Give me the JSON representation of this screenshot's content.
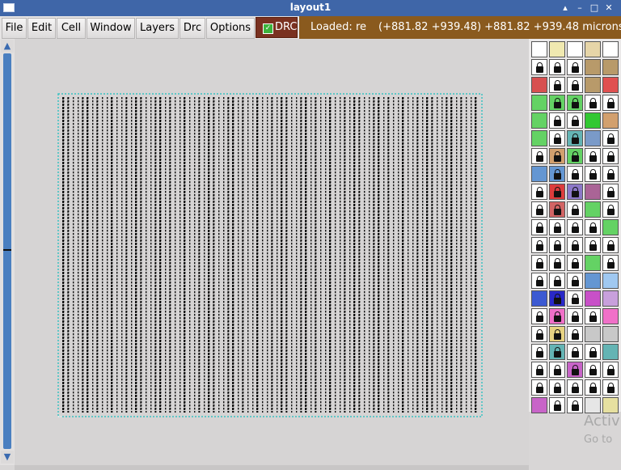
{
  "window": {
    "title": "layout1",
    "controls": [
      "▴",
      "–",
      "□",
      "✕"
    ]
  },
  "menu": [
    {
      "label": "File"
    },
    {
      "label": "Edit"
    },
    {
      "label": "Cell"
    },
    {
      "label": "Window"
    },
    {
      "label": "Layers"
    },
    {
      "label": "Drc"
    },
    {
      "label": "Options"
    }
  ],
  "drc_toggle": {
    "label": "DRC",
    "checked": true
  },
  "status": {
    "loaded": "Loaded: re",
    "coords": "(+881.82 +939.48) +881.82 +939.48 microns"
  },
  "layout": {
    "layer_color": "#000000",
    "boundary_color": "#39c2c2"
  },
  "palette": {
    "rows": [
      [
        "#ffffff",
        "#f0e9b0",
        "#ffffff",
        "#e6d5a8",
        "#ffffff"
      ],
      [
        "#ffffff",
        "#ffffff",
        "#ffffff",
        "#b89a6a",
        "#b89a6a"
      ],
      [
        "#d85050",
        "#ffffff",
        "#ffffff",
        "#b89a6a",
        "#e05050"
      ],
      [
        "#64d264",
        "#64d264",
        "#64d264",
        "#ffffff",
        "#ffffff"
      ],
      [
        "#64d264",
        "#ffffff",
        "#ffffff",
        "#32c832",
        "#d2a06e"
      ],
      [
        "#64d264",
        "#ffffff",
        "#64b4b4",
        "#7a9ac8",
        "#ffffff"
      ],
      [
        "#ffffff",
        "#d2a06e",
        "#64d264",
        "#ffffff",
        "#ffffff"
      ],
      [
        "#6496d2",
        "#6496d2",
        "#ffffff",
        "#ffffff",
        "#ffffff"
      ],
      [
        "#ffffff",
        "#dc3c3c",
        "#8c78c8",
        "#aa6496",
        "#ffffff"
      ],
      [
        "#ffffff",
        "#d26464",
        "#ffffff",
        "#64d264",
        "#ffffff"
      ],
      [
        "#ffffff",
        "#ffffff",
        "#ffffff",
        "#ffffff",
        "#64d264"
      ],
      [
        "#ffffff",
        "#ffffff",
        "#ffffff",
        "#ffffff",
        "#ffffff"
      ],
      [
        "#ffffff",
        "#ffffff",
        "#ffffff",
        "#64d264",
        "#ffffff"
      ],
      [
        "#ffffff",
        "#ffffff",
        "#ffffff",
        "#6496d2",
        "#a0c8f0"
      ],
      [
        "#3c5ad2",
        "#2828c8",
        "#ffffff",
        "#c850c8",
        "#c8a0dc"
      ],
      [
        "#ffffff",
        "#f070c8",
        "#ffffff",
        "#ffffff",
        "#f070c8"
      ],
      [
        "#ffffff",
        "#e6d282",
        "#ffffff",
        "#c8c8c8",
        "#c8c8c8"
      ],
      [
        "#ffffff",
        "#64b4b4",
        "#ffffff",
        "#ffffff",
        "#64b4b4"
      ],
      [
        "#ffffff",
        "#ffffff",
        "#c864c8",
        "#ffffff",
        "#ffffff"
      ],
      [
        "#ffffff",
        "#ffffff",
        "#ffffff",
        "#ffffff",
        "#ffffff"
      ],
      [
        "#c864c8",
        "#ffffff",
        "#ffffff",
        "#e6e6e6",
        "#e6e0a0"
      ]
    ]
  },
  "watermark": {
    "line1": "Activ",
    "line2": "Go to"
  }
}
